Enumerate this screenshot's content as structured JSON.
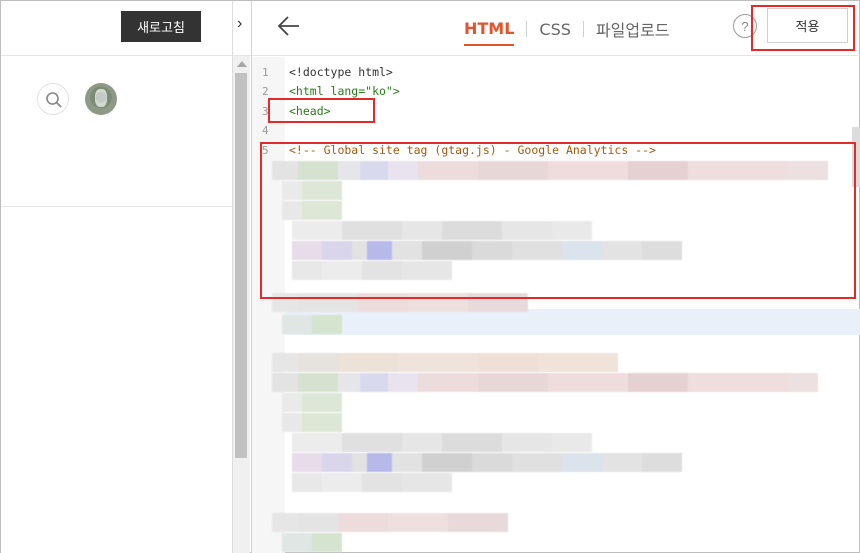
{
  "left_panel": {
    "refresh_label": "새로고침",
    "expand_toggle": "›"
  },
  "editor": {
    "tabs": [
      {
        "label": "HTML",
        "active": true
      },
      {
        "label": "CSS",
        "active": false
      },
      {
        "label": "파일업로드",
        "active": false
      }
    ],
    "help_label": "?",
    "apply_label": "적용",
    "lines": [
      {
        "num": "1",
        "text": "<!doctype html>"
      },
      {
        "num": "2",
        "text": "<html lang=\"ko\">"
      },
      {
        "num": "3",
        "text": "<head>"
      },
      {
        "num": "4",
        "text": ""
      },
      {
        "num": "5",
        "text": "<!-- Global site tag (gtag.js) - Google Analytics -->"
      }
    ]
  },
  "colors": {
    "accent": "#e4532b",
    "annotation": "#e12b2b",
    "tag": "#2a7a1a"
  }
}
